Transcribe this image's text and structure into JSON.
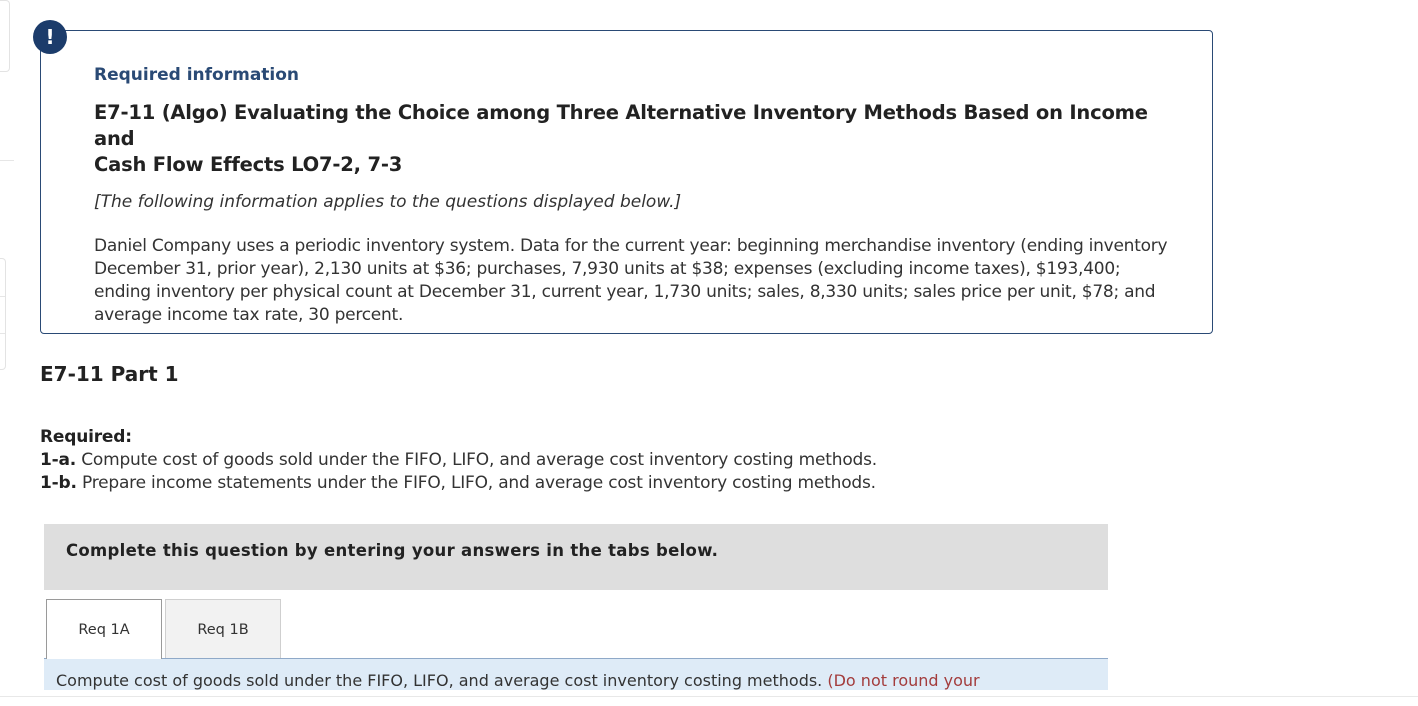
{
  "alert": {
    "icon": "exclamation-icon",
    "glyph": "!"
  },
  "info": {
    "heading": "Required information",
    "title_line1": "E7-11 (Algo) Evaluating the Choice among Three Alternative Inventory Methods Based on Income and",
    "title_line2": "Cash Flow Effects LO7-2, 7-3",
    "note": "[The following information applies to the questions displayed below.]",
    "body": "Daniel Company uses a periodic inventory system. Data for the current year: beginning merchandise inventory (ending inventory December 31, prior year), 2,130 units at $36; purchases, 7,930 units at $38; expenses (excluding income taxes), $193,400; ending inventory per physical count at December 31, current year, 1,730 units; sales, 8,330 units; sales price per unit, $78; and average income tax rate, 30 percent."
  },
  "part": {
    "title": "E7-11 Part 1"
  },
  "required": {
    "label": "Required:",
    "items": [
      {
        "key": "1-a.",
        "text": "Compute cost of goods sold under the FIFO, LIFO, and average cost inventory costing methods."
      },
      {
        "key": "1-b.",
        "text": "Prepare income statements under the FIFO, LIFO, and average cost inventory costing methods."
      }
    ]
  },
  "complete_panel": {
    "text": "Complete this question by entering your answers in the tabs below."
  },
  "tabs": [
    {
      "label": "Req 1A",
      "active": true
    },
    {
      "label": "Req 1B",
      "active": false
    }
  ],
  "instruction": {
    "text": "Compute cost of goods sold under the FIFO, LIFO, and average cost inventory costing methods.",
    "note": "(Do not round your"
  },
  "colors": {
    "accent_navy": "#1c3c6b",
    "heading_blue": "#2a4a75",
    "panel_gray": "#dedede",
    "instruction_bg": "#deebf7",
    "note_red": "#a33c3c"
  }
}
